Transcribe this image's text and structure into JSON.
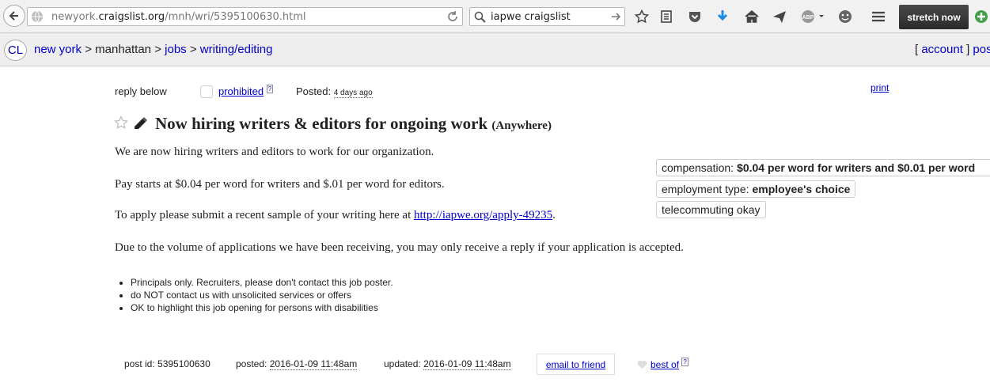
{
  "browser": {
    "url_prefix": "newyork.",
    "url_domain": "craigslist.org",
    "url_path": "/mnh/wri/5395100630.html",
    "search_query": "iapwe craigslist",
    "stretch_button": "stretch now",
    "icons": [
      "back-arrow-icon",
      "globe-icon",
      "reload-icon",
      "search-icon",
      "go-arrow-icon",
      "bookmark-star-icon",
      "reading-list-icon",
      "pocket-icon",
      "download-icon",
      "home-icon",
      "send-icon",
      "adblock-icon",
      "smiley-icon",
      "menu-icon",
      "add-icon"
    ]
  },
  "breadcrumb": {
    "logo": "CL",
    "city": "new york",
    "sep": ">",
    "area": "manhattan",
    "section": "jobs",
    "category": "writing/editing",
    "account_open": "[",
    "account": "account",
    "account_close": "]",
    "post": "pos"
  },
  "posting": {
    "reply_below": "reply below",
    "prohibited": "prohibited",
    "help_mark": "?",
    "posted_label": "Posted:",
    "posted_ago": "4 days ago",
    "print": "print",
    "title": "Now hiring writers & editors for ongoing work",
    "location": "(Anywhere)",
    "body": {
      "p1": "We are now hiring writers and editors to work for our organization.",
      "p2": "Pay starts at $0.04 per word for writers and $.01 per word for editors.",
      "p3_prefix": "To apply please submit a recent sample of your writing here at ",
      "p3_link": "http://iapwe.org/apply-49235",
      "p3_suffix": ".",
      "p4": "Due to the volume of applications we have been receiving, you may only receive a reply if your application is accepted."
    },
    "attributes": {
      "compensation_label": "compensation:",
      "compensation_value": "$0.04 per word for writers and $0.01 per word",
      "employment_label": "employment type:",
      "employment_value": "employee's choice",
      "telecommuting": "telecommuting okay"
    },
    "notices": [
      "Principals only. Recruiters, please don't contact this job poster.",
      "do NOT contact us with unsolicited services or offers",
      "OK to highlight this job opening for persons with disabilities"
    ],
    "footer": {
      "post_id": "post id: 5395100630",
      "posted_label": "posted:",
      "posted_date": "2016-01-09 11:48am",
      "updated_label": "updated:",
      "updated_date": "2016-01-09 11:48am",
      "email_friend": "email to friend",
      "best_of": "best of"
    }
  }
}
